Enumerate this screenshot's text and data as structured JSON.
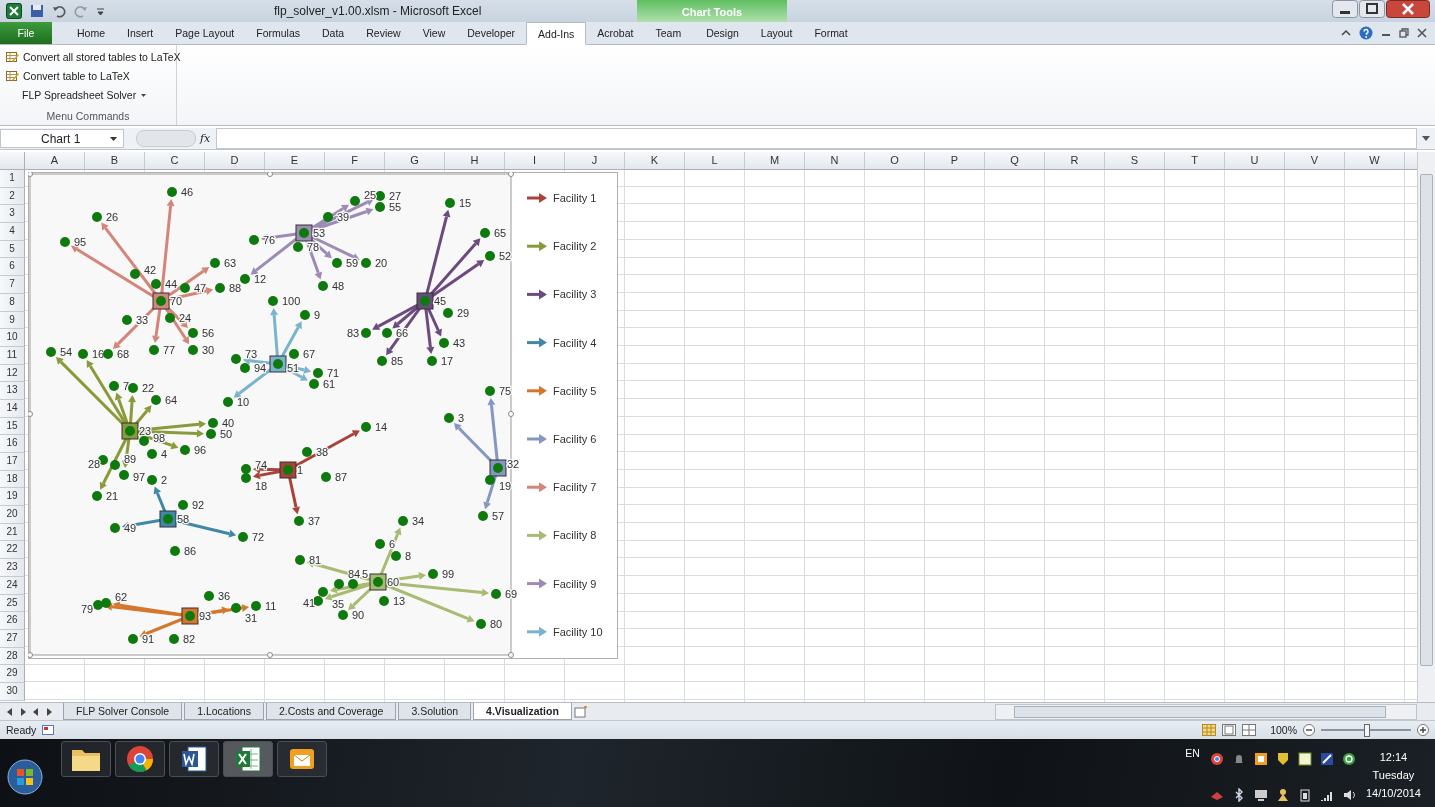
{
  "window": {
    "title": "flp_solver_v1.00.xlsm - Microsoft Excel"
  },
  "ribbon_tabs": [
    {
      "label": "File",
      "kind": "file",
      "selected": false
    },
    {
      "label": "Home",
      "kind": "tab",
      "selected": false
    },
    {
      "label": "Insert",
      "kind": "tab",
      "selected": false
    },
    {
      "label": "Page Layout",
      "kind": "tab",
      "selected": false
    },
    {
      "label": "Formulas",
      "kind": "tab",
      "selected": false
    },
    {
      "label": "Data",
      "kind": "tab",
      "selected": false
    },
    {
      "label": "Review",
      "kind": "tab",
      "selected": false
    },
    {
      "label": "View",
      "kind": "tab",
      "selected": false
    },
    {
      "label": "Developer",
      "kind": "tab",
      "selected": false
    },
    {
      "label": "Add-Ins",
      "kind": "tab",
      "selected": true
    },
    {
      "label": "Acrobat",
      "kind": "tab",
      "selected": false
    },
    {
      "label": "Team",
      "kind": "tab",
      "selected": false
    }
  ],
  "chart_tools": {
    "title": "Chart Tools",
    "tabs": [
      {
        "label": "Design",
        "selected": false
      },
      {
        "label": "Layout",
        "selected": false
      },
      {
        "label": "Format",
        "selected": false
      }
    ]
  },
  "ribbon_group": {
    "name": "Menu Commands",
    "commands": [
      {
        "label": "Convert all stored tables to LaTeX",
        "kind": "icon"
      },
      {
        "label": "Convert table to LaTeX",
        "kind": "icon"
      },
      {
        "label": "FLP Spreadsheet Solver",
        "kind": "dropdown"
      }
    ]
  },
  "formula_bar": {
    "name_box": "Chart 1",
    "function_label": "fx"
  },
  "columns": [
    "A",
    "B",
    "C",
    "D",
    "E",
    "F",
    "G",
    "H",
    "I",
    "J",
    "K",
    "L",
    "M",
    "N",
    "O",
    "P",
    "Q",
    "R",
    "S",
    "T",
    "U",
    "V",
    "W"
  ],
  "rows": [
    "1",
    "2",
    "3",
    "4",
    "5",
    "6",
    "7",
    "8",
    "9",
    "10",
    "11",
    "12",
    "13",
    "14",
    "15",
    "16",
    "17",
    "18",
    "19",
    "20",
    "21",
    "22",
    "23",
    "24",
    "25",
    "26",
    "27",
    "28",
    "29",
    "30"
  ],
  "chart": {
    "facilities": [
      {
        "legend": "Facility 1",
        "color": "#a8433b",
        "hub": "1",
        "customers": [
          "14",
          "38",
          "87",
          "37",
          "74",
          "18"
        ]
      },
      {
        "legend": "Facility 2",
        "color": "#8a9a3a",
        "hub": "23",
        "customers": [
          "54",
          "16",
          "7",
          "22",
          "64",
          "40",
          "50",
          "98",
          "4",
          "96",
          "28",
          "89",
          "97",
          "21"
        ]
      },
      {
        "legend": "Facility 3",
        "color": "#6b4a80",
        "hub": "45",
        "customers": [
          "15",
          "65",
          "52",
          "29",
          "83",
          "66",
          "43",
          "85",
          "17"
        ]
      },
      {
        "legend": "Facility 4",
        "color": "#3f88a8",
        "hub": "58",
        "customers": [
          "2",
          "92",
          "49",
          "72",
          "86"
        ]
      },
      {
        "legend": "Facility 5",
        "color": "#d4772c",
        "hub": "93",
        "customers": [
          "79",
          "62",
          "36",
          "31",
          "11",
          "91",
          "82"
        ]
      },
      {
        "legend": "Facility 6",
        "color": "#8497c2",
        "hub": "32",
        "customers": [
          "75",
          "3",
          "19",
          "57"
        ]
      },
      {
        "legend": "Facility 7",
        "color": "#d4857a",
        "hub": "70",
        "customers": [
          "46",
          "26",
          "95",
          "42",
          "44",
          "63",
          "47",
          "88",
          "33",
          "24",
          "56",
          "68",
          "77",
          "30"
        ]
      },
      {
        "legend": "Facility 8",
        "color": "#a9bb72",
        "hub": "60",
        "customers": [
          "34",
          "6",
          "8",
          "81",
          "99",
          "69",
          "80",
          "13",
          "90",
          "41",
          "35",
          "84",
          "5"
        ]
      },
      {
        "legend": "Facility 9",
        "color": "#9d8bb5",
        "hub": "53",
        "customers": [
          "27",
          "25",
          "55",
          "39",
          "76",
          "78",
          "59",
          "20",
          "12",
          "48"
        ]
      },
      {
        "legend": "Facility 10",
        "color": "#7ab3cb",
        "hub": "51",
        "customers": [
          "100",
          "9",
          "73",
          "94",
          "67",
          "71",
          "61",
          "10"
        ]
      }
    ]
  },
  "sheet_tabs": [
    {
      "label": "FLP Solver Console",
      "selected": false
    },
    {
      "label": "1.Locations",
      "selected": false
    },
    {
      "label": "2.Costs and Coverage",
      "selected": false
    },
    {
      "label": "3.Solution",
      "selected": false
    },
    {
      "label": "4.Visualization",
      "selected": true
    }
  ],
  "status_bar": {
    "state": "Ready",
    "zoom": "100%",
    "zoom_slider": {
      "level": 0.5
    }
  },
  "taskbar": {
    "language": "EN",
    "time": "12:14",
    "day": "Tuesday",
    "date": "14/10/2014"
  }
}
